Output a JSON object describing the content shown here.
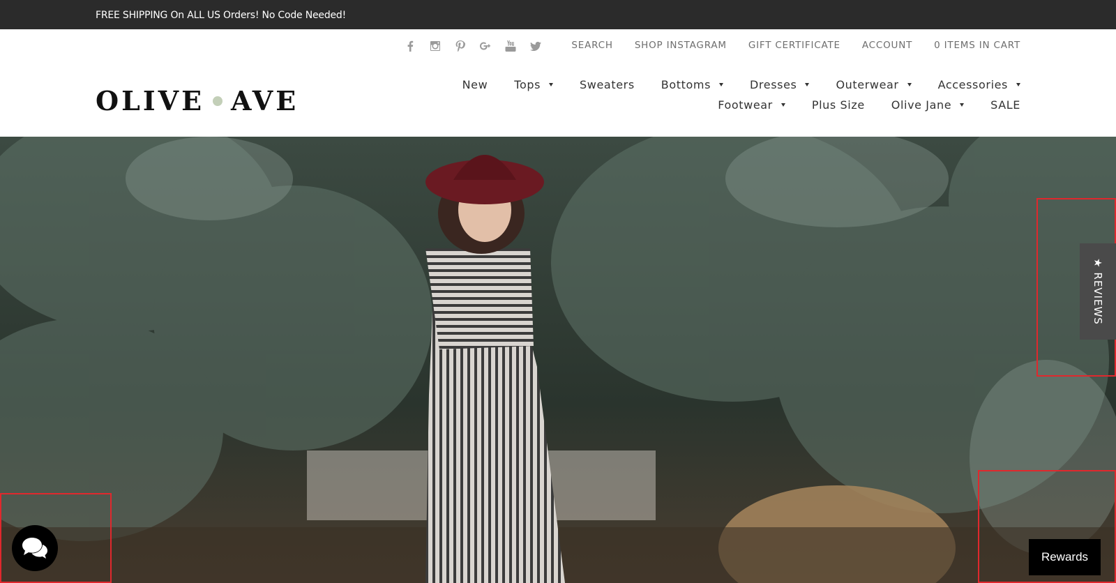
{
  "announcement": {
    "text": "FREE SHIPPING On ALL US Orders!  No Code Needed!"
  },
  "social": [
    "facebook-icon",
    "instagram-icon",
    "pinterest-icon",
    "google-plus-icon",
    "youtube-icon",
    "twitter-icon"
  ],
  "utility_nav": {
    "search": "SEARCH",
    "shop_instagram": "SHOP INSTAGRAM",
    "gift_certificate": "GIFT CERTIFICATE",
    "account": "ACCOUNT",
    "cart": "0 ITEMS IN CART"
  },
  "logo": {
    "left": "OLIVE",
    "right": "AVE"
  },
  "main_nav": {
    "new": "New",
    "tops": "Tops",
    "sweaters": "Sweaters",
    "bottoms": "Bottoms",
    "dresses": "Dresses",
    "outerwear": "Outerwear",
    "accessories": "Accessories",
    "footwear": "Footwear",
    "plus_size": "Plus Size",
    "olive_jane": "Olive Jane",
    "sale": "SALE"
  },
  "widgets": {
    "reviews": "★ REVIEWS",
    "rewards": "Rewards"
  },
  "colors": {
    "announcement_bg": "#2b2b2b",
    "logo_dot": "#c3cfb8",
    "reviews_tab": "#4a4a4a",
    "highlight": "#e0282d"
  }
}
